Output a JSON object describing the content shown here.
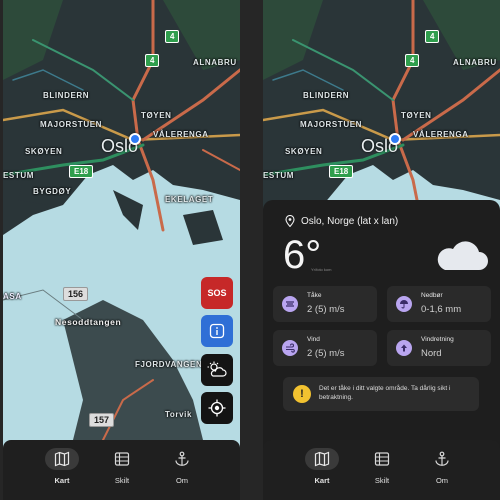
{
  "left_screen": {
    "map_labels": {
      "alnabru": "ALNABRU",
      "blindern": "BLINDERN",
      "toyen": "TØYEN",
      "majorstuen": "MAJORSTUEN",
      "valerenga": "VÅLERENGA",
      "skoyen": "SKØYEN",
      "city": "Oslo",
      "estum": "ESTUM",
      "bygdoy": "BYGDØY",
      "ekelaget": "EKELAGET",
      "nesoddtangen": "Nesoddtangen",
      "fjordvangen": "FJORDVANGEN",
      "torvik": "Torvik",
      "aasa": "ASA",
      "e18": "E18",
      "r4a": "4",
      "r4b": "4",
      "r156": "156",
      "r157": "157"
    },
    "buttons": {
      "sos": "SOS"
    },
    "colors": {
      "sos": "#c62828",
      "info": "#2f6fd6",
      "pin": "#2f7bf5"
    }
  },
  "right_screen": {
    "map_labels": {
      "alnabru": "ALNABRU",
      "blindern": "BLINDERN",
      "toyen": "TØYEN",
      "majorstuen": "MAJORSTUEN",
      "valerenga": "VÅLERENGA",
      "skoyen": "SKØYEN",
      "city": "Oslo",
      "estum": "ESTUM",
      "e18": "E18",
      "r4a": "4",
      "r4b": "4"
    },
    "weather": {
      "location": "Oslo, Norge (lat x lan)",
      "temperature": "6°",
      "credit": "Yr/foto kom",
      "tiles": [
        {
          "title": "Tåke",
          "value": "2 (5) m/s",
          "icon": "fog-icon"
        },
        {
          "title": "Nedbør",
          "value": "0-1,6 mm",
          "icon": "umbrella-icon"
        },
        {
          "title": "Vind",
          "value": "2 (5) m/s",
          "icon": "wind-icon"
        },
        {
          "title": "Vindretning",
          "value": "Nord",
          "icon": "arrow-up-icon"
        }
      ],
      "notice": "Det er tåke i ditt valgte område. Ta dårlig sikt i betraktning.",
      "notice_icon": "!"
    }
  },
  "nav": {
    "items": [
      {
        "label": "Kart",
        "icon": "map-icon"
      },
      {
        "label": "Skilt",
        "icon": "sign-icon"
      },
      {
        "label": "Om",
        "icon": "anchor-icon"
      }
    ]
  }
}
